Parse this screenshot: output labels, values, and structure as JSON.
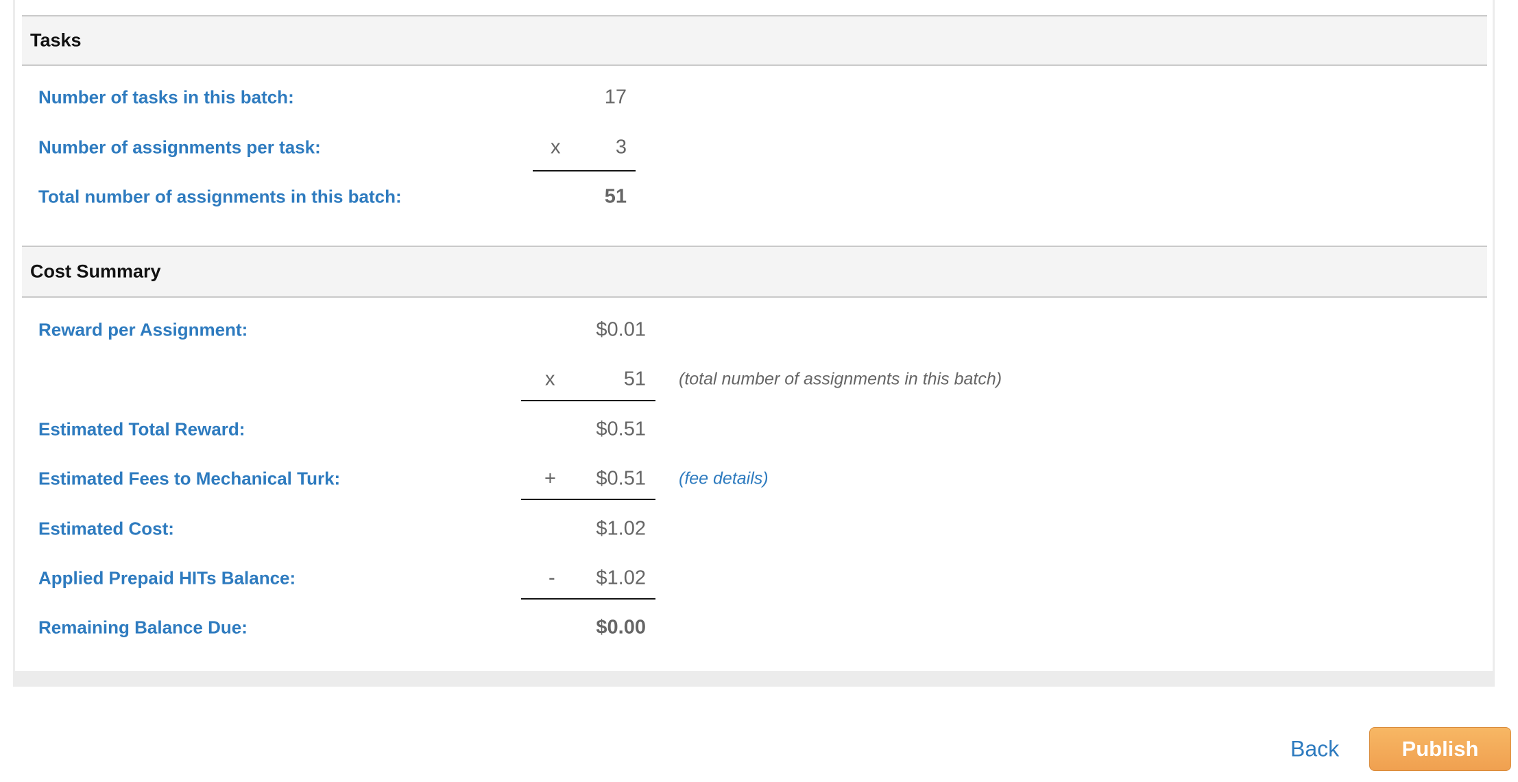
{
  "tasks": {
    "title": "Tasks",
    "rows": [
      {
        "label": "Number of tasks in this batch:",
        "operator": "",
        "value": "17"
      },
      {
        "label": "Number of assignments per task:",
        "operator": "x",
        "value": "3"
      },
      {
        "label": "Total number of assignments in this batch:",
        "operator": "",
        "value": "51"
      }
    ]
  },
  "cost_summary": {
    "title": "Cost Summary",
    "rows": [
      {
        "label": "Reward per Assignment:",
        "operator": "",
        "value": "$0.01",
        "note": ""
      },
      {
        "label": "",
        "operator": "x",
        "value": "51",
        "note": "(total number of assignments in this batch)"
      },
      {
        "label": "Estimated Total Reward:",
        "operator": "",
        "value": "$0.51",
        "note": ""
      },
      {
        "label": "Estimated Fees to Mechanical Turk:",
        "operator": "+",
        "value": "$0.51",
        "note": "(fee details)"
      },
      {
        "label": "Estimated Cost:",
        "operator": "",
        "value": "$1.02",
        "note": ""
      },
      {
        "label": "Applied Prepaid HITs Balance:",
        "operator": "-",
        "value": "$1.02",
        "note": ""
      },
      {
        "label": "Remaining Balance Due:",
        "operator": "",
        "value": "$0.00",
        "note": ""
      }
    ]
  },
  "actions": {
    "back_label": "Back",
    "publish_label": "Publish"
  },
  "colors": {
    "label_blue": "#2e7bbf",
    "publish_orange": "#f0a050",
    "value_gray": "#666666"
  }
}
